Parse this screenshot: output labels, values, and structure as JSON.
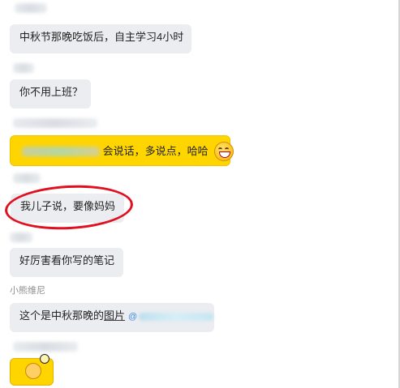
{
  "messages": [
    {
      "text": "中秋节那晚吃饭后，自主学习4小时"
    },
    {
      "text": "你不用上班？"
    },
    {
      "text": "会说话，多说点，哈哈"
    },
    {
      "text": "我儿子说，要像妈妈"
    },
    {
      "text": "好厉害看你写的笔记"
    },
    {
      "sender": "小熊维尼",
      "text_prefix": "这个是中秋那晚的",
      "text_link": "图片"
    }
  ],
  "colors": {
    "bubble_gray": "#ebedf0",
    "bubble_yellow": "#ffd500",
    "highlight_red": "#e01020"
  },
  "icons": [
    "laughing-emoji-icon",
    "thumbs-up-sticker-icon",
    "at-mention-icon"
  ]
}
